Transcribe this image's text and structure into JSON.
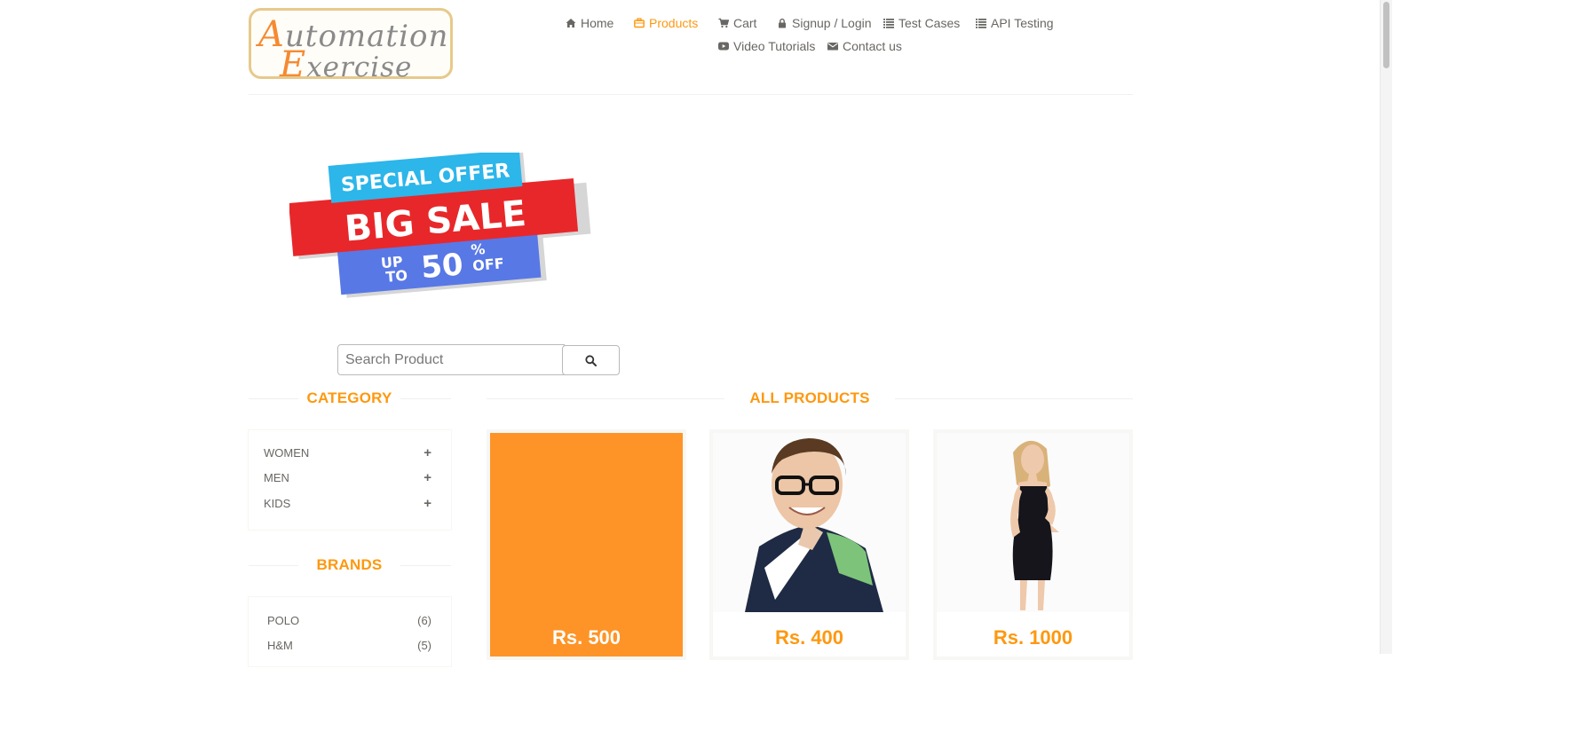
{
  "logo": {
    "alt": "Automation Exercise",
    "line1_cap": "A",
    "line1_rest": "utomation",
    "line2_cap": "E",
    "line2_rest": "xercise"
  },
  "nav": {
    "home": "Home",
    "products": "Products",
    "cart": "Cart",
    "signup": "Signup / Login",
    "test_cases": "Test Cases",
    "api_testing": "API Testing",
    "video_tutorials": "Video Tutorials",
    "contact": "Contact us",
    "active": "products"
  },
  "banner": {
    "line1": "SPECIAL OFFER",
    "line2": "BIG SALE",
    "up": "UP",
    "to": "TO",
    "percent": "50",
    "pct_sign": "%",
    "off": "OFF"
  },
  "search": {
    "placeholder": "Search Product",
    "icon": "search-icon"
  },
  "sidebar": {
    "category_title": "Category",
    "categories": [
      {
        "label": "WOMEN",
        "toggle": "+"
      },
      {
        "label": "MEN",
        "toggle": "+"
      },
      {
        "label": "KIDS",
        "toggle": "+"
      }
    ],
    "brands_title": "Brands",
    "brands": [
      {
        "label": "POLO",
        "count": "(6)"
      },
      {
        "label": "H&M",
        "count": "(5)"
      }
    ]
  },
  "main": {
    "title": "All Products",
    "products": [
      {
        "price": "Rs. 500",
        "state": "hover-overlay"
      },
      {
        "price": "Rs. 400",
        "image": "man-with-glasses"
      },
      {
        "price": "Rs. 1000",
        "image": "woman-black-dress"
      }
    ]
  },
  "colors": {
    "accent": "#fe980f",
    "text": "#696763",
    "banner_red": "#e8272a",
    "banner_cyan": "#2cb6ea",
    "banner_blue": "#5878e6"
  }
}
